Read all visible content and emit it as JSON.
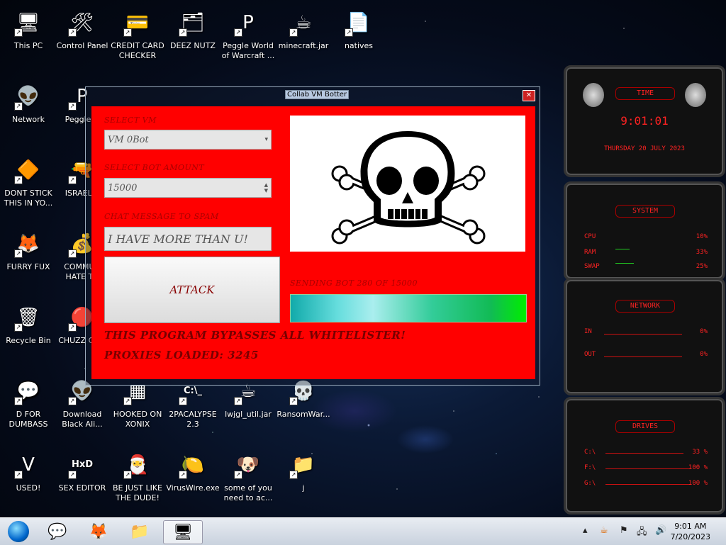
{
  "desktop_icons": [
    {
      "label": "This PC",
      "glyph": "🖥"
    },
    {
      "label": "Control Panel",
      "glyph": "🛠"
    },
    {
      "label": "CREDIT CARD CHECKER",
      "glyph": "💳"
    },
    {
      "label": "DEEZ NUTZ",
      "glyph": "🗂"
    },
    {
      "label": "Peggle World of Warcraft ...",
      "glyph": "P"
    },
    {
      "label": "minecraft.jar",
      "glyph": "☕"
    },
    {
      "label": "natives",
      "glyph": "📄"
    },
    {
      "label": "Network",
      "glyph": "👽"
    },
    {
      "label": "Peggle D",
      "glyph": "P"
    },
    {
      "label": "DONT STICK THIS IN YO...",
      "glyph": "🔶"
    },
    {
      "label": "ISRAEL S",
      "glyph": "🔫"
    },
    {
      "label": "FURRY FUX",
      "glyph": "🦊"
    },
    {
      "label": "COMMUN HATE TH",
      "glyph": "💰"
    },
    {
      "label": "Recycle Bin",
      "glyph": "🗑"
    },
    {
      "label": "CHUZZ CUM",
      "glyph": "🔴"
    },
    {
      "label": "D FOR DUMBASS",
      "glyph": "💬"
    },
    {
      "label": "Download Black Ali...",
      "glyph": "👽"
    },
    {
      "label": "HOOKED ON XONIX",
      "glyph": "▦"
    },
    {
      "label": "2PACALYPSE 2.3",
      "glyph": "C:\\_"
    },
    {
      "label": "lwjgl_util.jar",
      "glyph": "☕"
    },
    {
      "label": "RansomWar...",
      "glyph": "💀"
    },
    {
      "label": "USED!",
      "glyph": "V"
    },
    {
      "label": "SEX EDITOR",
      "glyph": "HxD"
    },
    {
      "label": "BE JUST LIKE THE DUDE!",
      "glyph": "🎅"
    },
    {
      "label": "VirusWire.exe",
      "glyph": "🍋"
    },
    {
      "label": "some of you need to ac...",
      "glyph": "🐶"
    },
    {
      "label": "j",
      "glyph": "📁"
    }
  ],
  "app": {
    "window_title": "Collab VM Botter",
    "close_label": "✕",
    "select_vm_label": "SELECT VM",
    "select_vm_value": "VM 0Bot",
    "select_bot_label": "SELECT BOT AMOUNT",
    "bot_amount_value": "15000",
    "chat_label": "CHAT MESSAGE TO SPAM",
    "chat_value": "I HAVE MORE THAN U!",
    "attack_label": "ATTACK",
    "status_text": "SENDING BOT 280 OF 15000",
    "progress": 1.0,
    "bypass_text": "THIS PROGRAM BYPASSES ALL WHITELISTER!",
    "proxies_text": "PROXIES LOADED: 3245"
  },
  "widgets": {
    "time": {
      "title": "TIME",
      "time": "9:01:01",
      "date": "THURSDAY 20 JULY 2023"
    },
    "system": {
      "title": "SYSTEM",
      "rows": [
        {
          "name": "CPU",
          "value": "10%"
        },
        {
          "name": "RAM",
          "value": "33%"
        },
        {
          "name": "SWAP",
          "value": "25%"
        }
      ]
    },
    "network": {
      "title": "NETWORK",
      "rows": [
        {
          "name": "IN",
          "value": "0%"
        },
        {
          "name": "OUT",
          "value": "0%"
        }
      ]
    },
    "drives": {
      "title": "DRIVES",
      "rows": [
        {
          "name": "C:\\",
          "value": "33 %"
        },
        {
          "name": "F:\\",
          "value": "100 %"
        },
        {
          "name": "G:\\",
          "value": "100 %"
        }
      ]
    }
  },
  "taskbar": {
    "clock_time": "9:01 AM",
    "clock_date": "7/20/2023"
  }
}
